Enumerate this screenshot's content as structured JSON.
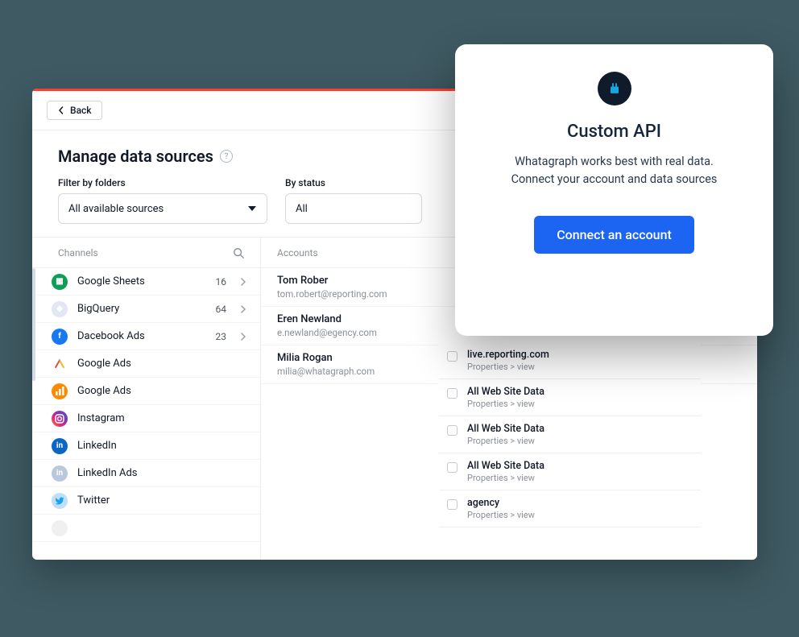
{
  "back_label": "Back",
  "page_title": "Manage data sources",
  "filters": {
    "folders_label": "Filter by folders",
    "folders_value": "All available sources",
    "status_label": "By status",
    "status_value": "All"
  },
  "channels_header": "Channels",
  "accounts_header": "Accounts",
  "channels": [
    {
      "name": "Google Sheets",
      "count": "16",
      "has_chevron": true,
      "icon": "sheets"
    },
    {
      "name": "BigQuery",
      "count": "64",
      "has_chevron": true,
      "icon": "bq"
    },
    {
      "name": "Dacebook Ads",
      "count": "23",
      "has_chevron": true,
      "icon": "fb"
    },
    {
      "name": "Google Ads",
      "count": "",
      "has_chevron": false,
      "icon": "ga"
    },
    {
      "name": "Google Ads",
      "count": "",
      "has_chevron": false,
      "icon": "ga2"
    },
    {
      "name": "Instagram",
      "count": "",
      "has_chevron": false,
      "icon": "ig"
    },
    {
      "name": "LinkedIn",
      "count": "",
      "has_chevron": false,
      "icon": "li"
    },
    {
      "name": "LinkedIn Ads",
      "count": "",
      "has_chevron": false,
      "icon": "li2"
    },
    {
      "name": "Twitter",
      "count": "",
      "has_chevron": false,
      "icon": "tw"
    },
    {
      "name": "",
      "count": "",
      "has_chevron": false,
      "icon": "blank"
    }
  ],
  "accounts": [
    {
      "name": "Tom Rober",
      "email": "tom.robert@reporting.com"
    },
    {
      "name": "Eren Newland",
      "email": "e.newland@egency.com"
    },
    {
      "name": "Milia Rogan",
      "email": "milia@whatagraph.com"
    }
  ],
  "sources": [
    {
      "title": "live.reporting.com",
      "sub": "Properties > view"
    },
    {
      "title": "All Web Site Data",
      "sub": "Properties > view"
    },
    {
      "title": "All Web Site Data",
      "sub": "Properties > view"
    },
    {
      "title": "All Web Site Data",
      "sub": "Properties > view"
    },
    {
      "title": "agency",
      "sub": "Properties > view"
    }
  ],
  "modal": {
    "title": "Custom API",
    "line1": "Whatagraph works best with real data.",
    "line2": "Connect your account and data sources",
    "cta": "Connect an account"
  }
}
